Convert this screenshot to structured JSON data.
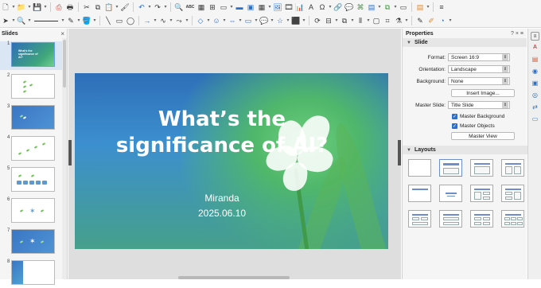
{
  "toolbar": {
    "spellcheck_label": "ABC"
  },
  "slides_panel": {
    "title": "Slides",
    "thumbnails": [
      {
        "number": "1",
        "title": "What's the significance of AI?"
      },
      {
        "number": "2"
      },
      {
        "number": "3"
      },
      {
        "number": "4"
      },
      {
        "number": "5"
      },
      {
        "number": "6"
      },
      {
        "number": "7"
      },
      {
        "number": "8"
      }
    ]
  },
  "slide": {
    "title": "What’s the significance of AI?",
    "author": "Miranda",
    "date": "2025.06.10"
  },
  "properties": {
    "title": "Properties",
    "help": "?",
    "close": "×",
    "menu": "≡",
    "slide_section": "Slide",
    "format_label": "Format:",
    "format_value": "Screen 16:9",
    "orientation_label": "Orientation:",
    "orientation_value": "Landscape",
    "background_label": "Background:",
    "background_value": "None",
    "insert_image": "Insert Image...",
    "master_slide_label": "Master Slide:",
    "master_slide_value": "Title Slide",
    "master_background": "Master Background",
    "master_objects": "Master Objects",
    "master_view": "Master View",
    "layouts_section": "Layouts"
  },
  "colors": {
    "accent": "#2b6fd1",
    "slide_blue": "#2e6fb8",
    "slide_green": "#46a08a"
  }
}
